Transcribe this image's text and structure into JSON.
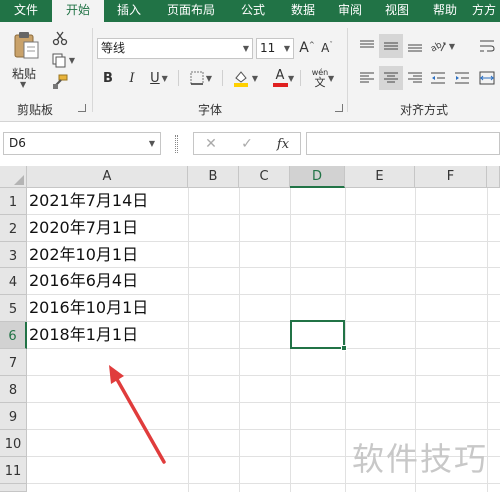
{
  "tabs": [
    "文件",
    "开始",
    "插入",
    "页面布局",
    "公式",
    "数据",
    "审阅",
    "视图",
    "帮助",
    "方方"
  ],
  "ribbon": {
    "clipboard": {
      "paste_label": "粘贴",
      "group_label": "剪贴板"
    },
    "font": {
      "font_name": "等线",
      "font_size": "11",
      "bold": "B",
      "italic": "I",
      "underline": "U",
      "grow_font": "A",
      "shrink_font": "A",
      "font_color_letter": "A",
      "phonetic_top": "wén",
      "phonetic_bottom": "文",
      "group_label": "字体"
    },
    "alignment": {
      "group_label": "对齐方式"
    }
  },
  "formula_bar": {
    "name_box": "D6",
    "fx_label": "fx",
    "formula": ""
  },
  "sheet": {
    "columns": [
      "A",
      "B",
      "C",
      "D",
      "E",
      "F"
    ],
    "active_column": "D",
    "rows": [
      "1",
      "2",
      "3",
      "4",
      "5",
      "6",
      "7",
      "8",
      "9",
      "10",
      "11"
    ],
    "active_row": "6",
    "column_a_values": [
      "2021年7月14日",
      "2020年7月1日",
      "202年10月1日",
      "2016年6月4日",
      "2016年10月1日",
      "2018年1月1日"
    ],
    "selected_cell": "D6"
  },
  "watermark": "软件技巧",
  "colors": {
    "excel_green": "#217346",
    "arrow_red": "#e03c3c"
  },
  "icons": [
    "scissors-icon",
    "copy-icon",
    "format-painter-icon",
    "borders-icon",
    "fill-color-icon",
    "align-left-icon",
    "align-center-icon",
    "align-right-icon",
    "orientation-icon",
    "wrap-text-icon",
    "cancel-icon",
    "enter-icon"
  ]
}
